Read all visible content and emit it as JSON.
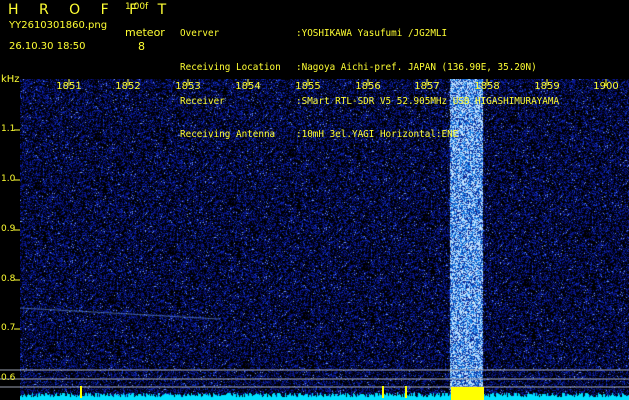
{
  "header": {
    "title": "H R O F F T",
    "version": "1.00f",
    "filename": "YY2610301860.png",
    "meteor_label": "meteor",
    "meteor_count": "8",
    "timestamp": "26.10.30 18:50"
  },
  "station": [
    {
      "key": "Overver",
      "value": ":YOSHIKAWA Yasufumi /JG2MLI"
    },
    {
      "key": "Receiving Location",
      "value": ":Nagoya Aichi-pref. JAPAN (136.90E, 35.20N)"
    },
    {
      "key": "Receiver",
      "value": ":SMart RTL-SDR V5 52.905MHz USB HIGASHIMURAYAMA"
    },
    {
      "key": "Receiving Antenna",
      "value": ":10mH 3el.YAGI Horizontal:ENE"
    }
  ],
  "axis": {
    "y_unit": "kHz",
    "y_ticks": [
      "1.1",
      "1.0",
      "0.9",
      "0.8",
      "0.7",
      "0.6"
    ],
    "x_ticks": [
      "1851",
      "1852",
      "1853",
      "1854",
      "1855",
      "1856",
      "1857",
      "1858",
      "1859",
      "1900"
    ]
  },
  "colors": {
    "text": "#ffff33",
    "background": "#000000",
    "noise": "#1030c0",
    "burst": "#60a0ff",
    "baseline": "#00e0ff",
    "marker": "#ffff00"
  }
}
